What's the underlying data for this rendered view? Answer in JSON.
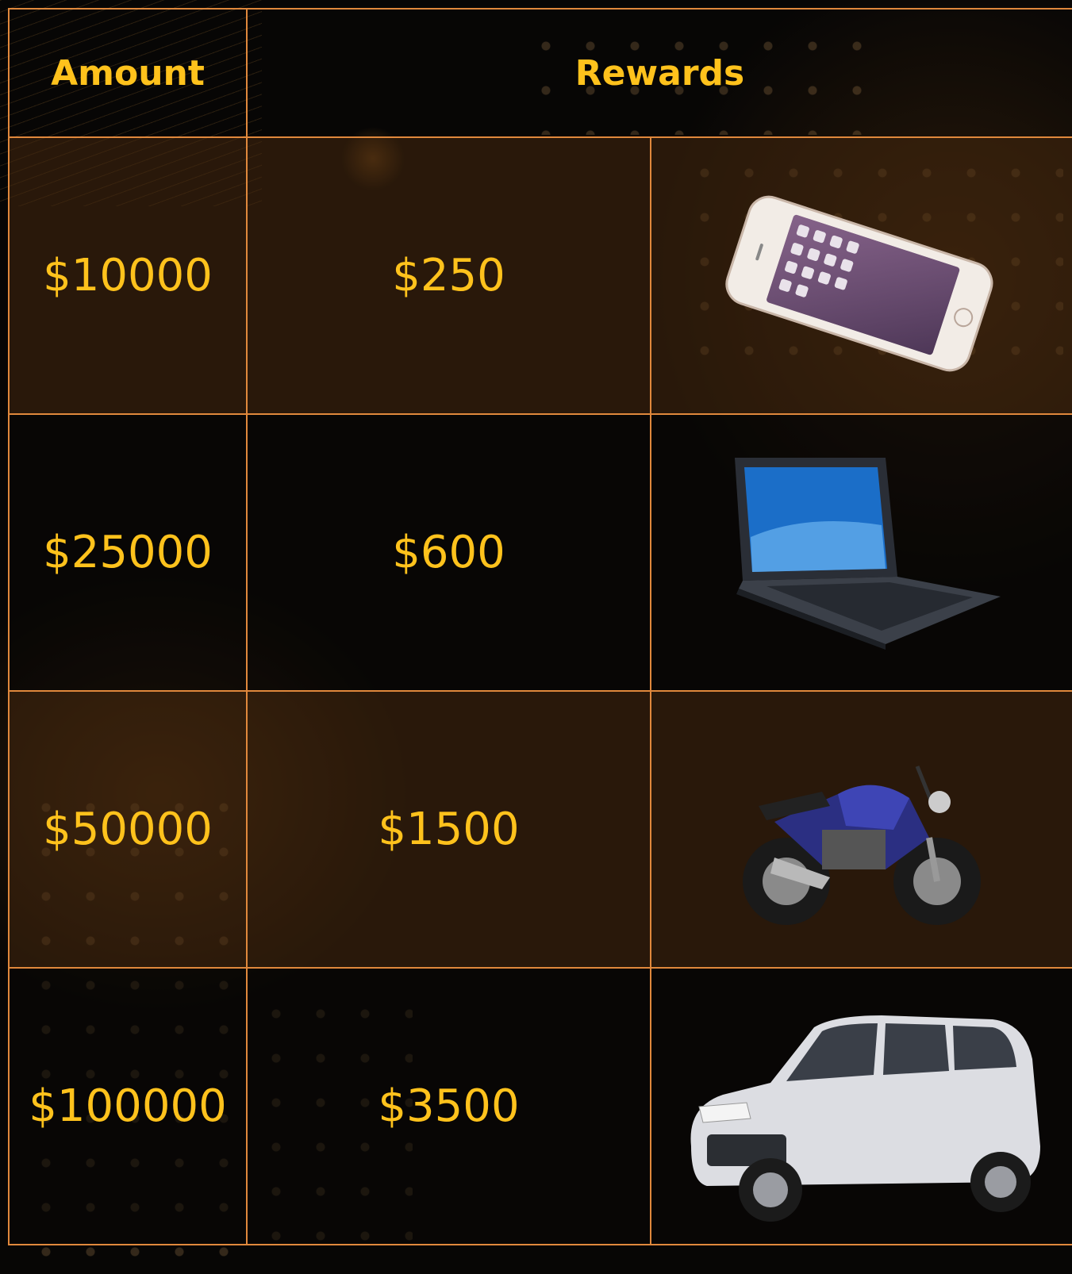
{
  "table": {
    "headers": {
      "amount": "Amount",
      "rewards": "Rewards"
    },
    "rows": [
      {
        "amount": "$10000",
        "reward": "$250",
        "prize_icon": "smartphone-icon"
      },
      {
        "amount": "$25000",
        "reward": "$600",
        "prize_icon": "laptop-icon"
      },
      {
        "amount": "$50000",
        "reward": "$1500",
        "prize_icon": "motorcycle-icon"
      },
      {
        "amount": "$100000",
        "reward": "$3500",
        "prize_icon": "car-icon"
      }
    ]
  },
  "colors": {
    "text": "#ffc21c",
    "border": "#e0883c",
    "background": "#070605",
    "warm_row": "#46280e"
  }
}
